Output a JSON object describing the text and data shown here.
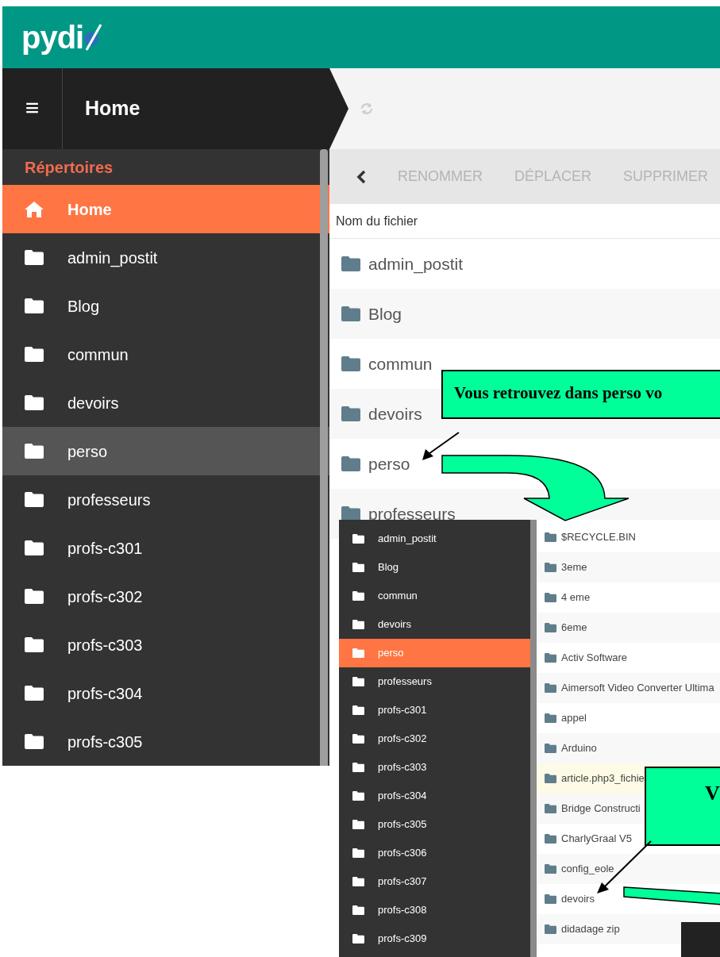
{
  "header": {
    "logo": "pydi"
  },
  "breadcrumb": {
    "menu_glyph": "≡",
    "title": "Home"
  },
  "sidebar": {
    "heading": "Répertoires",
    "items": [
      {
        "label": "Home",
        "kind": "home",
        "selected": true,
        "hovered": false
      },
      {
        "label": "admin_postit",
        "kind": "folder",
        "selected": false,
        "hovered": false
      },
      {
        "label": "Blog",
        "kind": "folder",
        "selected": false,
        "hovered": false
      },
      {
        "label": "commun",
        "kind": "folder",
        "selected": false,
        "hovered": false
      },
      {
        "label": "devoirs",
        "kind": "folder",
        "selected": false,
        "hovered": false
      },
      {
        "label": "perso",
        "kind": "folder",
        "selected": false,
        "hovered": true
      },
      {
        "label": "professeurs",
        "kind": "folder",
        "selected": false,
        "hovered": false
      },
      {
        "label": "profs-c301",
        "kind": "folder",
        "selected": false,
        "hovered": false
      },
      {
        "label": "profs-c302",
        "kind": "folder",
        "selected": false,
        "hovered": false
      },
      {
        "label": "profs-c303",
        "kind": "folder",
        "selected": false,
        "hovered": false
      },
      {
        "label": "profs-c304",
        "kind": "folder",
        "selected": false,
        "hovered": false
      },
      {
        "label": "profs-c305",
        "kind": "folder",
        "selected": false,
        "hovered": false
      }
    ]
  },
  "toolbar": {
    "actions": [
      "RENOMMER",
      "DÉPLACER",
      "SUPPRIMER"
    ]
  },
  "file_list": {
    "column": "Nom du fichier",
    "rows": [
      "admin_postit",
      "Blog",
      "commun",
      "devoirs",
      "perso",
      "professeurs"
    ]
  },
  "inset": {
    "sidebar": [
      {
        "label": "admin_postit",
        "selected": false
      },
      {
        "label": "Blog",
        "selected": false
      },
      {
        "label": "commun",
        "selected": false
      },
      {
        "label": "devoirs",
        "selected": false
      },
      {
        "label": "perso",
        "selected": true
      },
      {
        "label": "professeurs",
        "selected": false
      },
      {
        "label": "profs-c301",
        "selected": false
      },
      {
        "label": "profs-c302",
        "selected": false
      },
      {
        "label": "profs-c303",
        "selected": false
      },
      {
        "label": "profs-c304",
        "selected": false
      },
      {
        "label": "profs-c305",
        "selected": false
      },
      {
        "label": "profs-c306",
        "selected": false
      },
      {
        "label": "profs-c307",
        "selected": false
      },
      {
        "label": "profs-c308",
        "selected": false
      },
      {
        "label": "profs-c309",
        "selected": false
      }
    ],
    "files": [
      {
        "label": "$RECYCLE.BIN",
        "highlighted": false
      },
      {
        "label": "3eme",
        "highlighted": false
      },
      {
        "label": "4 eme",
        "highlighted": false
      },
      {
        "label": "6eme",
        "highlighted": false
      },
      {
        "label": "Activ Software",
        "highlighted": false
      },
      {
        "label": "Aimersoft Video Converter Ultima",
        "highlighted": false
      },
      {
        "label": "appel",
        "highlighted": false
      },
      {
        "label": "Arduino",
        "highlighted": false
      },
      {
        "label": "article.php3_fichie",
        "highlighted": true
      },
      {
        "label": "Bridge Constructi",
        "highlighted": false
      },
      {
        "label": "CharlyGraal V5",
        "highlighted": false
      },
      {
        "label": "config_eole",
        "highlighted": false
      },
      {
        "label": "devoirs",
        "highlighted": false
      },
      {
        "label": "didadage zip",
        "highlighted": false
      }
    ]
  },
  "callouts": [
    "Vous retrouvez dans perso vo",
    "V"
  ]
}
